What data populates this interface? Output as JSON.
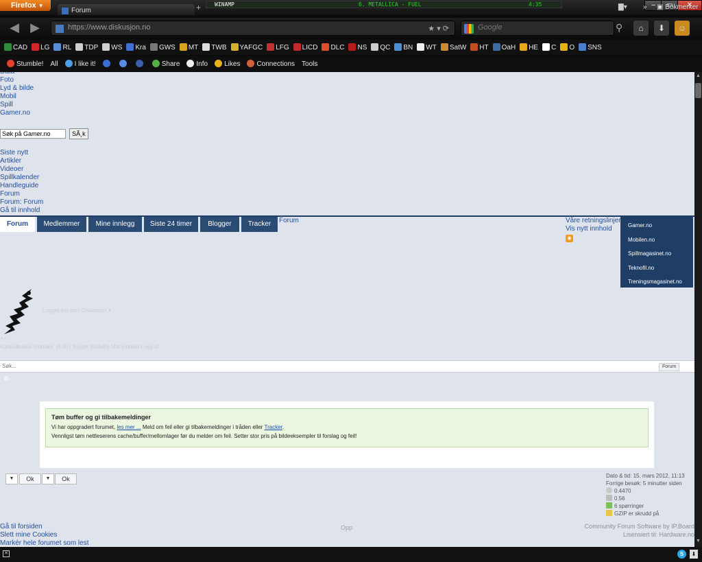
{
  "browser": {
    "firefox_button": "Firefox",
    "tab_title": "Forum",
    "url": "https://www.diskusjon.no",
    "search_engine": "Google",
    "search_placeholder": "Google",
    "winamp": {
      "label": "WINAMP",
      "track": "6. METALLICA - FUEL",
      "time": "4:35"
    }
  },
  "bookmarks": [
    {
      "label": "CAD",
      "color": "#2e8b3a"
    },
    {
      "label": "LG",
      "color": "#d3252a"
    },
    {
      "label": "RL",
      "color": "#5b8ed8"
    },
    {
      "label": "TDP",
      "color": "#cfcfcf"
    },
    {
      "label": "WS",
      "color": "#cfcfcf"
    },
    {
      "label": "Kra",
      "color": "#3f6fd1"
    },
    {
      "label": "GWS",
      "color": "#777777"
    },
    {
      "label": "MT",
      "color": "#d9a51e"
    },
    {
      "label": "TWB",
      "color": "#dddddd"
    },
    {
      "label": "YAFGC",
      "color": "#d6b02a"
    },
    {
      "label": "LFG",
      "color": "#c22f2f"
    },
    {
      "label": "LICD",
      "color": "#c2292d"
    },
    {
      "label": "DLC",
      "color": "#e04d2a"
    },
    {
      "label": "NS",
      "color": "#b71c1c"
    },
    {
      "label": "QC",
      "color": "#cccccc"
    },
    {
      "label": "BN",
      "color": "#4a90d9"
    },
    {
      "label": "WT",
      "color": "#eeeeee"
    },
    {
      "label": "SatW",
      "color": "#cc8833"
    },
    {
      "label": "HT",
      "color": "#c24e1e"
    },
    {
      "label": "OaH",
      "color": "#3a6ea5"
    },
    {
      "label": "HE",
      "color": "#e6a81a"
    },
    {
      "label": "C",
      "color": "#ffffff"
    },
    {
      "label": "O",
      "color": "#e6b20d"
    },
    {
      "label": "SNS",
      "color": "#4a7fd0"
    }
  ],
  "bookmarks_more": "»",
  "bookmarks_folder": "Bokmerker",
  "stumblebar": [
    {
      "label": "Stumble!",
      "color": "#e2412a"
    },
    {
      "label": "All",
      "color": "transparent"
    },
    {
      "label": "I like it!",
      "color": "#4aa0e6"
    },
    {
      "label": "",
      "color": "#3a6fd1"
    },
    {
      "label": "",
      "color": "#5a8be0"
    },
    {
      "label": "",
      "color": "#3a5fa8"
    },
    {
      "label": "Share",
      "color": "#56b04a"
    },
    {
      "label": "Info",
      "color": "#eeeeee"
    },
    {
      "label": "Likes",
      "color": "#e8b21a"
    },
    {
      "label": "Connections",
      "color": "#d0603a"
    },
    {
      "label": "Tools",
      "color": "transparent"
    }
  ],
  "top_links": [
    "Data",
    "Foto",
    "Lyd & bilde",
    "Mobil",
    "Spill",
    "Gamer.no"
  ],
  "top_search": {
    "value": "Søk på Gamer.no",
    "button": "SÃ¸k"
  },
  "sub_links": [
    "Siste nytt",
    "Artikler",
    "Videoer",
    "Spillkalender",
    "Handleguide",
    "Forum",
    "Forum: Forum",
    "Gå til innhold"
  ],
  "tabs": [
    "Forum",
    "Medlemmer",
    "Mine innlegg",
    "Siste 24 timer",
    "Blogger",
    "Tracker"
  ],
  "tab_forum_label": "Forum",
  "right_links": [
    "Våre retningslinjer",
    "Vis nytt innhold"
  ],
  "site_menu": [
    "Gamer.no",
    "Mobilen.no",
    "Spillmagasinet.no",
    "Teknofil.no",
    "Treningsmagasinet.no"
  ],
  "logged_in": "Logget inn som Datasmurf",
  "user_menu": "Kontrollpanel Innboks: (0 Ny) Toggle Visibility Mitt innhold Logg ut",
  "forum_search": {
    "placeholder": "Søk...",
    "button": "Forum"
  },
  "notice": {
    "title": "Tøm buffer og gi tilbakemeldinger",
    "line1_pre": "Vi har oppgradert forumet, ",
    "line1_link1": "les mer ...",
    "line1_mid": " Meld om feil eller gi tilbakemeldinger i tråden eller ",
    "line1_link2": "Tracker",
    "line1_post": ".",
    "line2": "Vennligst tøm nettleserens cache/buffer/mellomlager før du melder om feil. Setter stor pris på bildeeksempler til forslag og feil!"
  },
  "ok_label": "Ok",
  "stats": {
    "datetime": "Dato & tid: 15. mars 2012, 11:13",
    "last_visit": "Forrige besøk: 5 minutter siden",
    "v1": "0.4470",
    "v2": "0.56",
    "queries": "6 spørringer",
    "gzip": "GZIP er skrudd på"
  },
  "footer_links": [
    "Gå til forsiden",
    "Slett mine Cookies",
    "Markér hele forumet som lest"
  ],
  "top_link": "Opp",
  "footer_right": [
    "Community Forum Software by IP.Board",
    "Lisensiert til: Hardware.no"
  ]
}
